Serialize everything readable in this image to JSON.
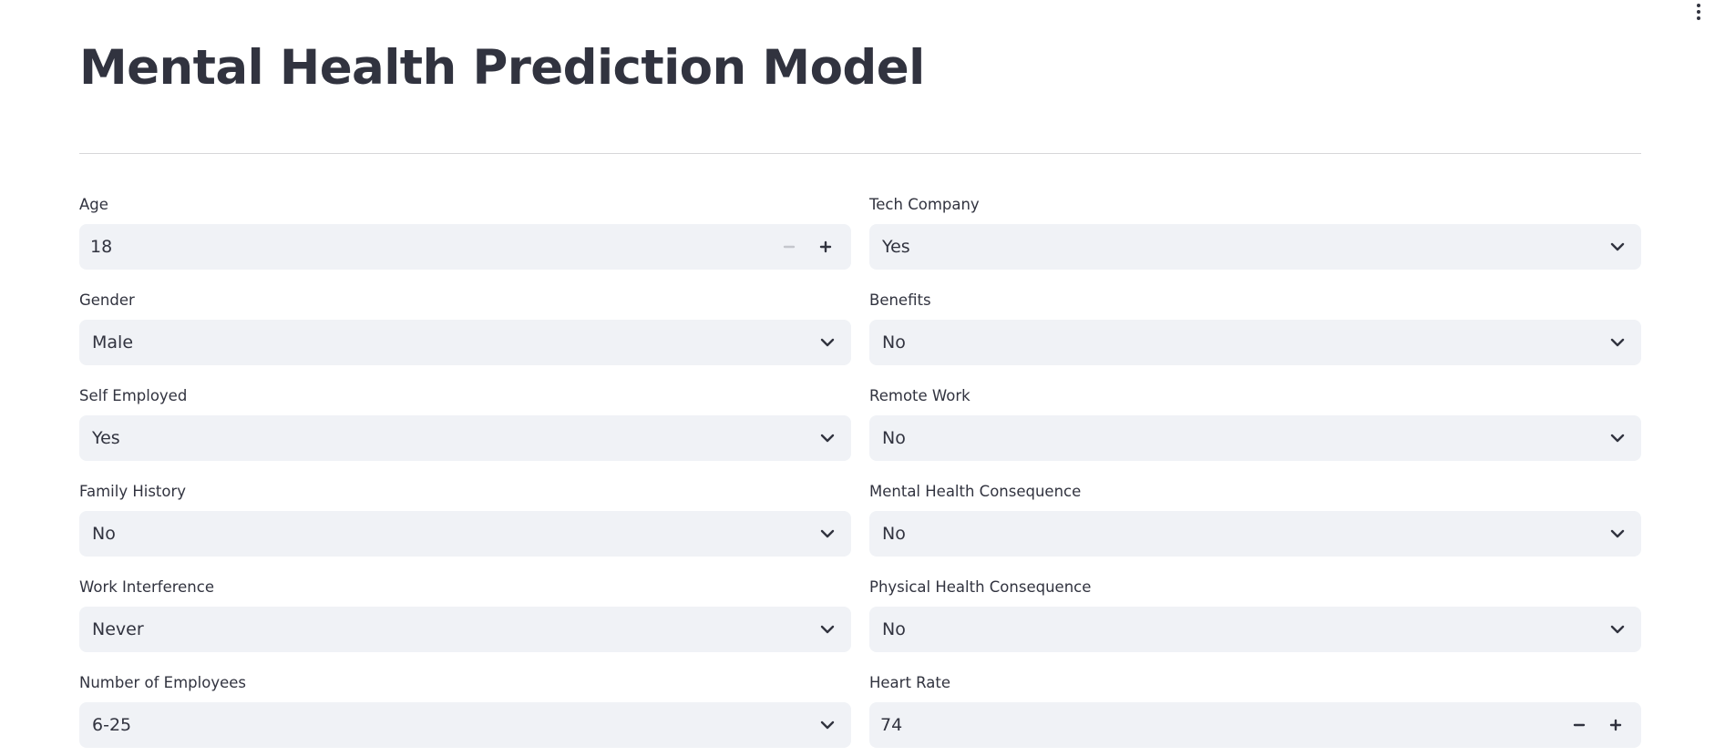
{
  "title": "Mental Health Prediction Model",
  "fields": {
    "age": {
      "label": "Age",
      "value": "18"
    },
    "tech_company": {
      "label": "Tech Company",
      "value": "Yes"
    },
    "gender": {
      "label": "Gender",
      "value": "Male"
    },
    "benefits": {
      "label": "Benefits",
      "value": "No"
    },
    "self_employed": {
      "label": "Self Employed",
      "value": "Yes"
    },
    "remote_work": {
      "label": "Remote Work",
      "value": "No"
    },
    "family_history": {
      "label": "Family History",
      "value": "No"
    },
    "mental_health_consequence": {
      "label": "Mental Health Consequence",
      "value": "No"
    },
    "work_interference": {
      "label": "Work Interference",
      "value": "Never"
    },
    "physical_health_consequence": {
      "label": "Physical Health Consequence",
      "value": "No"
    },
    "number_of_employees": {
      "label": "Number of Employees",
      "value": "6-25"
    },
    "heart_rate": {
      "label": "Heart Rate",
      "value": "74"
    }
  },
  "icons": {
    "menu": "vertical-dots-icon",
    "select": "chevron-down-icon",
    "decrement": "minus-icon",
    "increment": "plus-icon"
  },
  "colors": {
    "text": "#31333f",
    "input_background": "#f0f2f6",
    "divider": "#d6d6d9",
    "disabled": "#c4c6cc"
  }
}
